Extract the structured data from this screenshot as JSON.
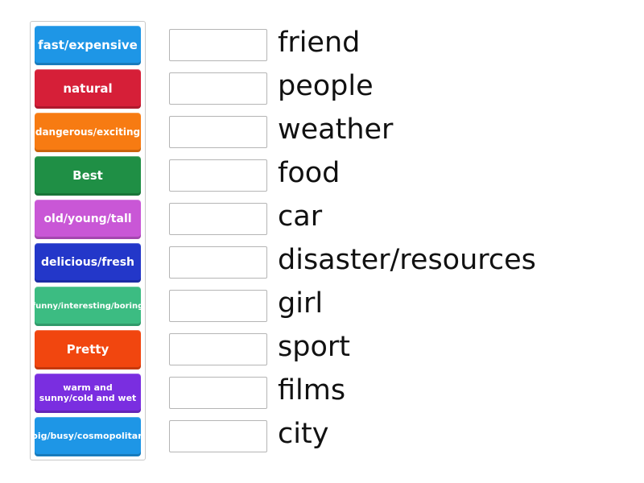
{
  "activity": {
    "type": "match-up",
    "tiles": [
      {
        "label": "fast/expensive",
        "color": "#1e96e6"
      },
      {
        "label": "natural",
        "color": "#d61f38"
      },
      {
        "label": "dangerous/exciting",
        "color": "#f77b12"
      },
      {
        "label": "Best",
        "color": "#1f8f45"
      },
      {
        "label": "old/young/tall",
        "color": "#c957d6"
      },
      {
        "label": "delicious/fresh",
        "color": "#2337c9"
      },
      {
        "label": "funny/interesting/boring",
        "color": "#3cbc82"
      },
      {
        "label": "Pretty",
        "color": "#f1460f"
      },
      {
        "label": "warm and sunny/cold and wet",
        "color": "#7a2ee0"
      },
      {
        "label": "big/busy/cosmopolitan",
        "color": "#1e96e6"
      }
    ],
    "targets": [
      {
        "word": "friend",
        "answer": ""
      },
      {
        "word": "people",
        "answer": ""
      },
      {
        "word": "weather",
        "answer": ""
      },
      {
        "word": "food",
        "answer": ""
      },
      {
        "word": "car",
        "answer": ""
      },
      {
        "word": "disaster/resources",
        "answer": ""
      },
      {
        "word": "girl",
        "answer": ""
      },
      {
        "word": "sport",
        "answer": ""
      },
      {
        "word": "films",
        "answer": ""
      },
      {
        "word": "city",
        "answer": ""
      }
    ]
  }
}
